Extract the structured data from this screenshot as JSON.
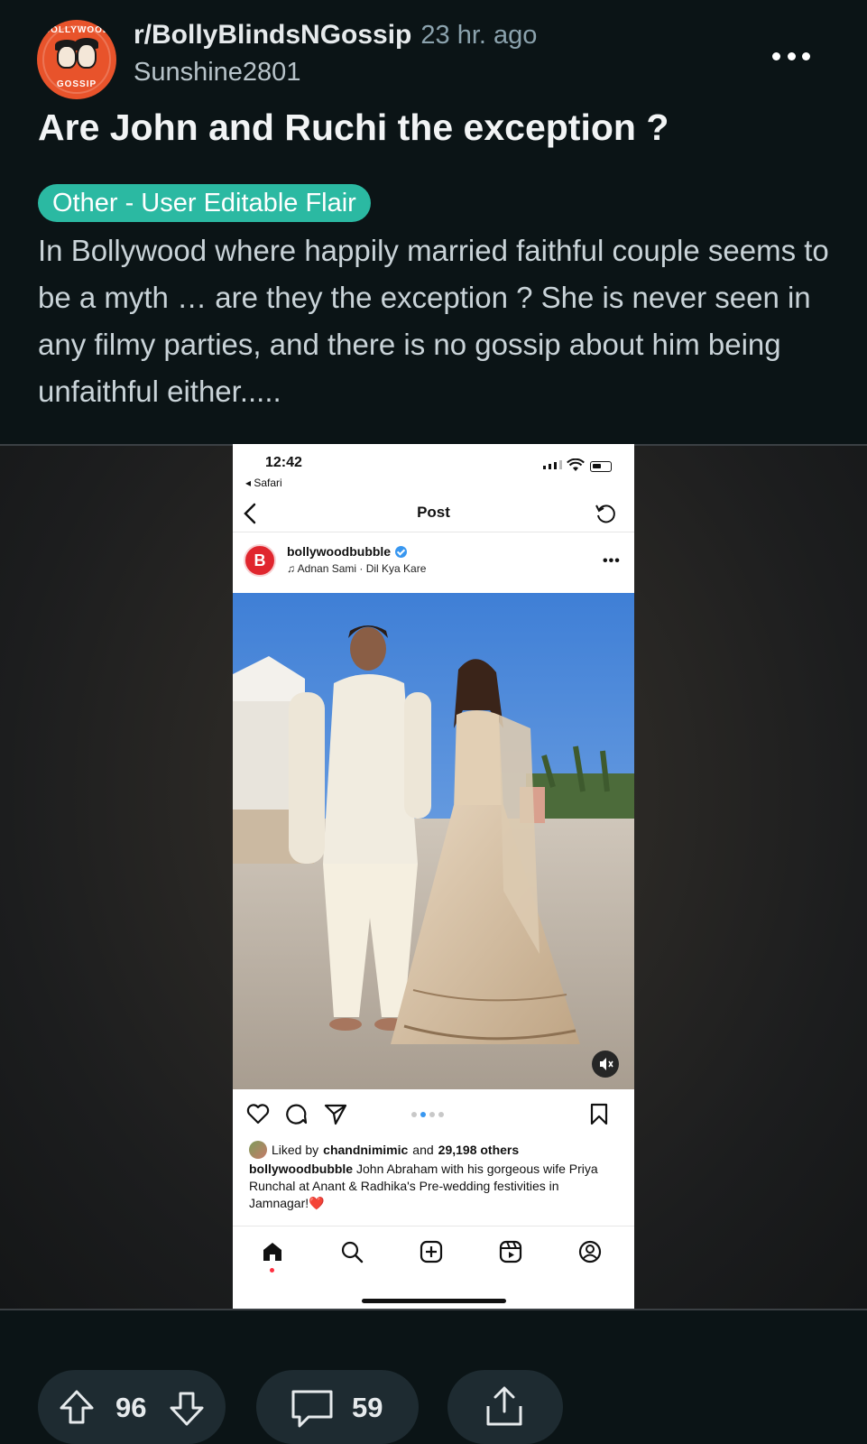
{
  "post": {
    "subreddit": "r/BollyBlindsNGossip",
    "time": "23 hr. ago",
    "author": "Sunshine2801",
    "title": "Are John and Ruchi the exception ?",
    "flair": "Other - User Editable Flair",
    "body": "In Bollywood where happily married faithful couple seems to be a myth … are they the exception ? She is never seen in any filmy parties, and there is no gossip about him being unfaithful either.....",
    "subreddit_avatar": {
      "top_text": "BOLLYWOOD",
      "bottom_text": "GOSSIP",
      "color": "#e8532b"
    },
    "flair_color": "#2bb9a2"
  },
  "screenshot": {
    "status_time": "12:42",
    "back_app": "◂ Safari",
    "nav_title": "Post",
    "account": "bollywoodbubble",
    "account_initial": "B",
    "song": "♫ Adnan Sami · Dil Kya Kare",
    "more": "•••",
    "likes_prefix": "Liked by",
    "likes_user": "chandnimimic",
    "likes_mid": "and",
    "likes_count": "29,198 others",
    "caption_user": "bollywoodbubble",
    "caption_text": "John Abraham with his gorgeous wife Priya Runchal at Anant & Radhika's Pre-wedding festivities in Jamnagar!❤️",
    "carousel_total": 4,
    "carousel_active": 2
  },
  "bottom": {
    "score": "96",
    "comments": "59"
  },
  "icons": {
    "more": "more-horizontal-icon",
    "upvote": "upvote-arrow-icon",
    "downvote": "downvote-arrow-icon",
    "comment": "comment-bubble-icon",
    "share": "share-icon"
  }
}
